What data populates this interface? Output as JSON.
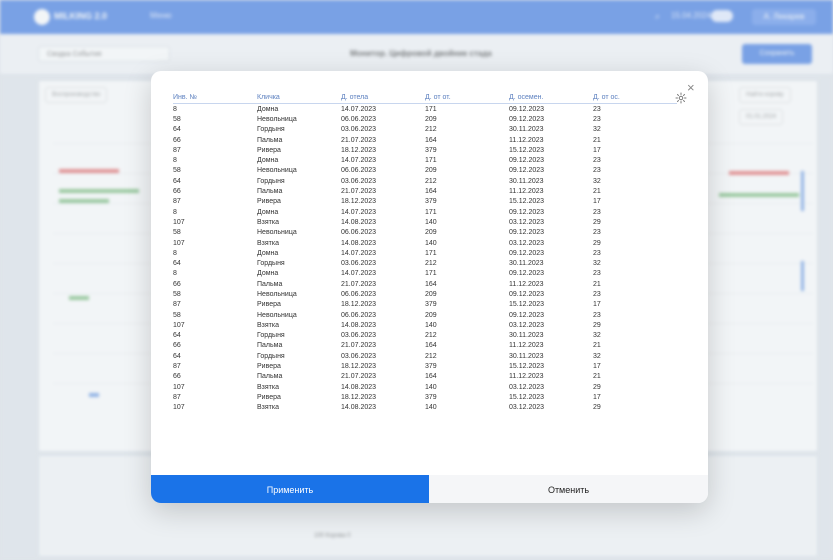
{
  "app": {
    "brand": "MILKING 2.0",
    "menu": "Меню",
    "date": "15.04.2024",
    "user": "А. Лекарев",
    "back_label": "Сводка  События",
    "page_title": "Монитор. Цифровой двойник стада",
    "save_label": "Сохранить",
    "filter_chip": "Воспроизводство",
    "find_label": "Найти корову",
    "panel_date": "01.01.2024",
    "footer_note": "100 Корова 0"
  },
  "table": {
    "columns": [
      "Инв. №",
      "Кличка",
      "Д. отела",
      "Д. от от.",
      "Д. осемен.",
      "Д. от ос."
    ],
    "rows": [
      [
        "8",
        "Домна",
        "14.07.2023",
        "171",
        "09.12.2023",
        "23"
      ],
      [
        "58",
        "Невольница",
        "06.06.2023",
        "209",
        "09.12.2023",
        "23"
      ],
      [
        "64",
        "Гордыня",
        "03.06.2023",
        "212",
        "30.11.2023",
        "32"
      ],
      [
        "66",
        "Пальма",
        "21.07.2023",
        "164",
        "11.12.2023",
        "21"
      ],
      [
        "87",
        "Ривера",
        "18.12.2023",
        "379",
        "15.12.2023",
        "17"
      ],
      [
        "8",
        "Домна",
        "14.07.2023",
        "171",
        "09.12.2023",
        "23"
      ],
      [
        "58",
        "Невольница",
        "06.06.2023",
        "209",
        "09.12.2023",
        "23"
      ],
      [
        "64",
        "Гордыня",
        "03.06.2023",
        "212",
        "30.11.2023",
        "32"
      ],
      [
        "66",
        "Пальма",
        "21.07.2023",
        "164",
        "11.12.2023",
        "21"
      ],
      [
        "87",
        "Ривера",
        "18.12.2023",
        "379",
        "15.12.2023",
        "17"
      ],
      [
        "8",
        "Домна",
        "14.07.2023",
        "171",
        "09.12.2023",
        "23"
      ],
      [
        "107",
        "Взятка",
        "14.08.2023",
        "140",
        "03.12.2023",
        "29"
      ],
      [
        "58",
        "Невольница",
        "06.06.2023",
        "209",
        "09.12.2023",
        "23"
      ],
      [
        "107",
        "Взятка",
        "14.08.2023",
        "140",
        "03.12.2023",
        "29"
      ],
      [
        "8",
        "Домна",
        "14.07.2023",
        "171",
        "09.12.2023",
        "23"
      ],
      [
        "64",
        "Гордыня",
        "03.06.2023",
        "212",
        "30.11.2023",
        "32"
      ],
      [
        "8",
        "Домна",
        "14.07.2023",
        "171",
        "09.12.2023",
        "23"
      ],
      [
        "66",
        "Пальма",
        "21.07.2023",
        "164",
        "11.12.2023",
        "21"
      ],
      [
        "58",
        "Невольница",
        "06.06.2023",
        "209",
        "09.12.2023",
        "23"
      ],
      [
        "87",
        "Ривера",
        "18.12.2023",
        "379",
        "15.12.2023",
        "17"
      ],
      [
        "58",
        "Невольница",
        "06.06.2023",
        "209",
        "09.12.2023",
        "23"
      ],
      [
        "107",
        "Взятка",
        "14.08.2023",
        "140",
        "03.12.2023",
        "29"
      ],
      [
        "64",
        "Гордыня",
        "03.06.2023",
        "212",
        "30.11.2023",
        "32"
      ],
      [
        "66",
        "Пальма",
        "21.07.2023",
        "164",
        "11.12.2023",
        "21"
      ],
      [
        "64",
        "Гордыня",
        "03.06.2023",
        "212",
        "30.11.2023",
        "32"
      ],
      [
        "87",
        "Ривера",
        "18.12.2023",
        "379",
        "15.12.2023",
        "17"
      ],
      [
        "66",
        "Пальма",
        "21.07.2023",
        "164",
        "11.12.2023",
        "21"
      ],
      [
        "107",
        "Взятка",
        "14.08.2023",
        "140",
        "03.12.2023",
        "29"
      ],
      [
        "87",
        "Ривера",
        "18.12.2023",
        "379",
        "15.12.2023",
        "17"
      ],
      [
        "107",
        "Взятка",
        "14.08.2023",
        "140",
        "03.12.2023",
        "29"
      ]
    ]
  },
  "dialog": {
    "close_icon": "close-icon",
    "settings_icon": "gear-icon",
    "apply_label": "Применить",
    "cancel_label": "Отменить"
  },
  "colors": {
    "accent": "#1a73e8",
    "header_text": "#5b7fbf",
    "topbar": "#2f6fe0"
  }
}
